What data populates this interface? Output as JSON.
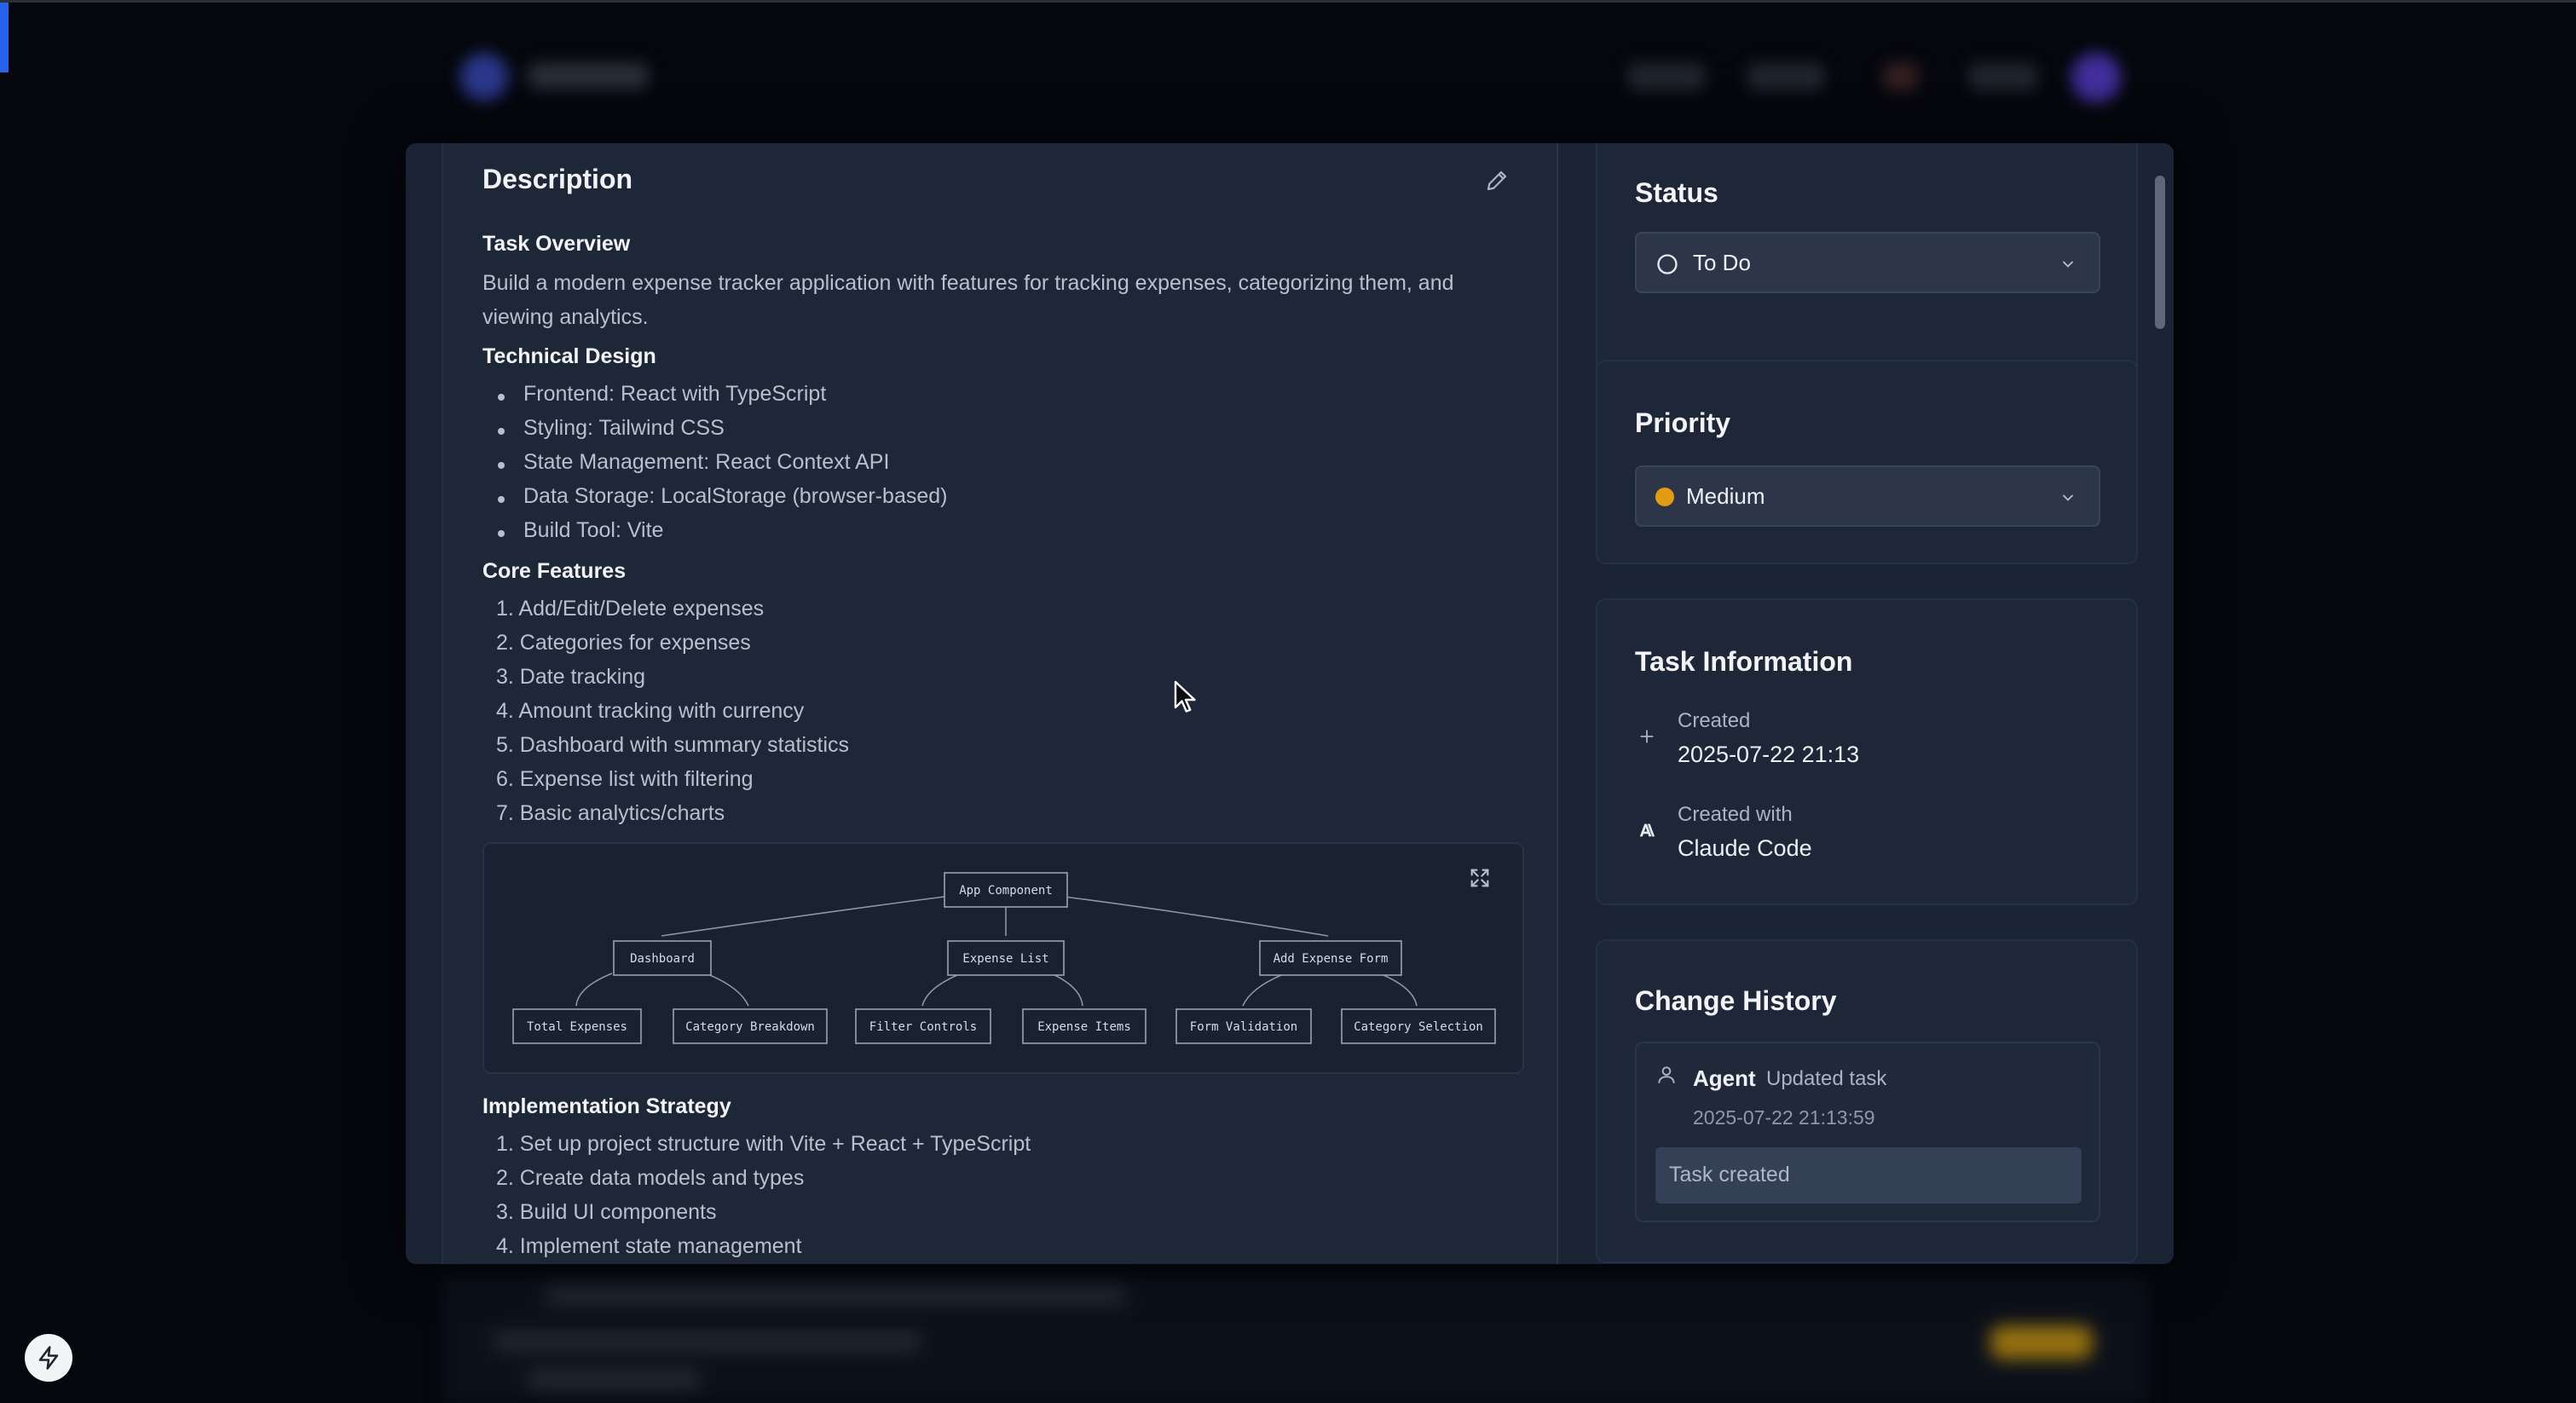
{
  "description": {
    "title": "Description",
    "task_overview": {
      "heading": "Task Overview",
      "text": "Build a modern expense tracker application with features for tracking expenses, categorizing them, and viewing analytics."
    },
    "technical_design": {
      "heading": "Technical Design",
      "items": [
        "Frontend: React with TypeScript",
        "Styling: Tailwind CSS",
        "State Management: React Context API",
        "Data Storage: LocalStorage (browser-based)",
        "Build Tool: Vite"
      ]
    },
    "core_features": {
      "heading": "Core Features",
      "items": [
        "1. Add/Edit/Delete expenses",
        "2. Categories for expenses",
        "3. Date tracking",
        "4. Amount tracking with currency",
        "5. Dashboard with summary statistics",
        "6. Expense list with filtering",
        "7. Basic analytics/charts"
      ]
    },
    "diagram": {
      "root": "App Component",
      "level1": [
        "Dashboard",
        "Expense List",
        "Add Expense Form"
      ],
      "level2": [
        "Total Expenses",
        "Category Breakdown",
        "Filter Controls",
        "Expense Items",
        "Form Validation",
        "Category Selection"
      ]
    },
    "implementation": {
      "heading": "Implementation Strategy",
      "items": [
        "1. Set up project structure with Vite + React + TypeScript",
        "2. Create data models and types",
        "3. Build UI components",
        "4. Implement state management"
      ]
    }
  },
  "status": {
    "title": "Status",
    "value": "To Do"
  },
  "priority": {
    "title": "Priority",
    "value": "Medium",
    "color": "#e39b12"
  },
  "task_info": {
    "title": "Task Information",
    "created_label": "Created",
    "created_value": "2025-07-22 21:13",
    "created_with_label": "Created with",
    "created_with_value": "Claude Code"
  },
  "history": {
    "title": "Change History",
    "items": [
      {
        "actor": "Agent",
        "action": "Updated task",
        "time": "2025-07-22 21:13:59",
        "note": "Task created"
      }
    ]
  }
}
